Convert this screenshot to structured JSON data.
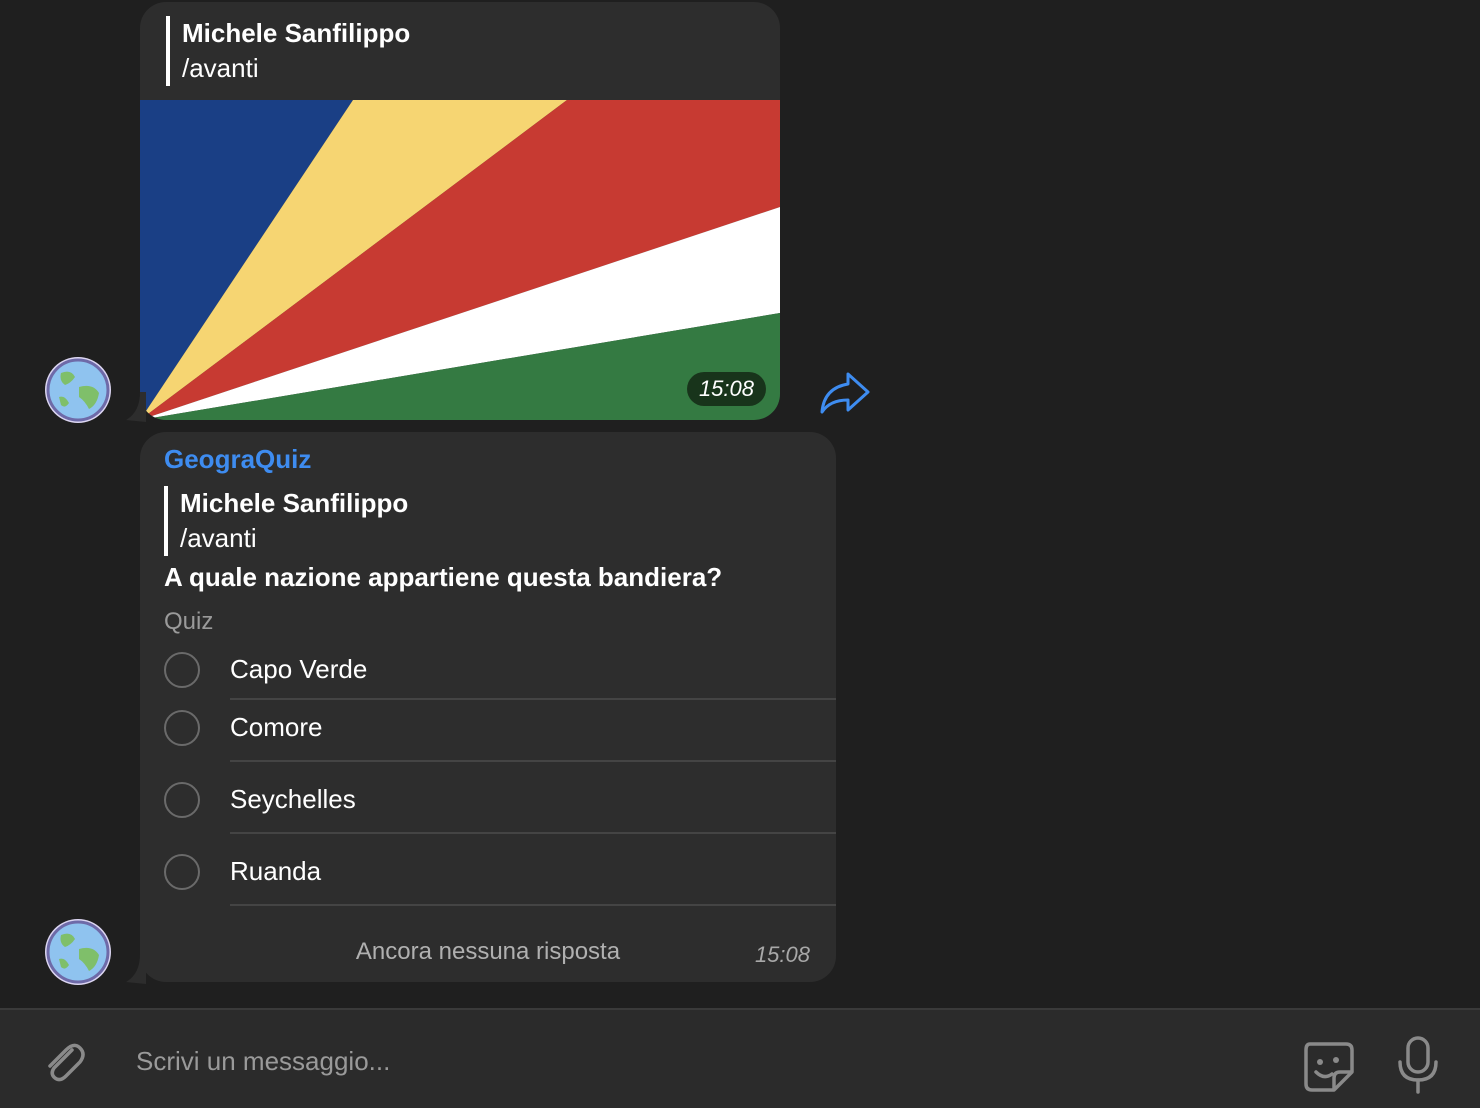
{
  "messages": {
    "photo": {
      "reply_to_name": "Michele Sanfilippo",
      "reply_to_text": "/avanti",
      "time": "15:08",
      "flag_colors": [
        "#1a3f85",
        "#f6d572",
        "#c73a32",
        "#ffffff",
        "#347a42"
      ]
    },
    "poll": {
      "sender": "GeograQuiz",
      "reply_to_name": "Michele Sanfilippo",
      "reply_to_text": "/avanti",
      "question": "A quale nazione appartiene questa bandiera?",
      "type_label": "Quiz",
      "options": [
        {
          "label": "Capo Verde"
        },
        {
          "label": "Comore"
        },
        {
          "label": "Seychelles"
        },
        {
          "label": "Ruanda"
        }
      ],
      "status": "Ancora nessuna risposta",
      "time": "15:08"
    }
  },
  "composer": {
    "placeholder": "Scrivi un messaggio..."
  },
  "colors": {
    "accent": "#3e8cf0",
    "bubble": "#2d2d2d",
    "background": "#1f1f1f"
  }
}
